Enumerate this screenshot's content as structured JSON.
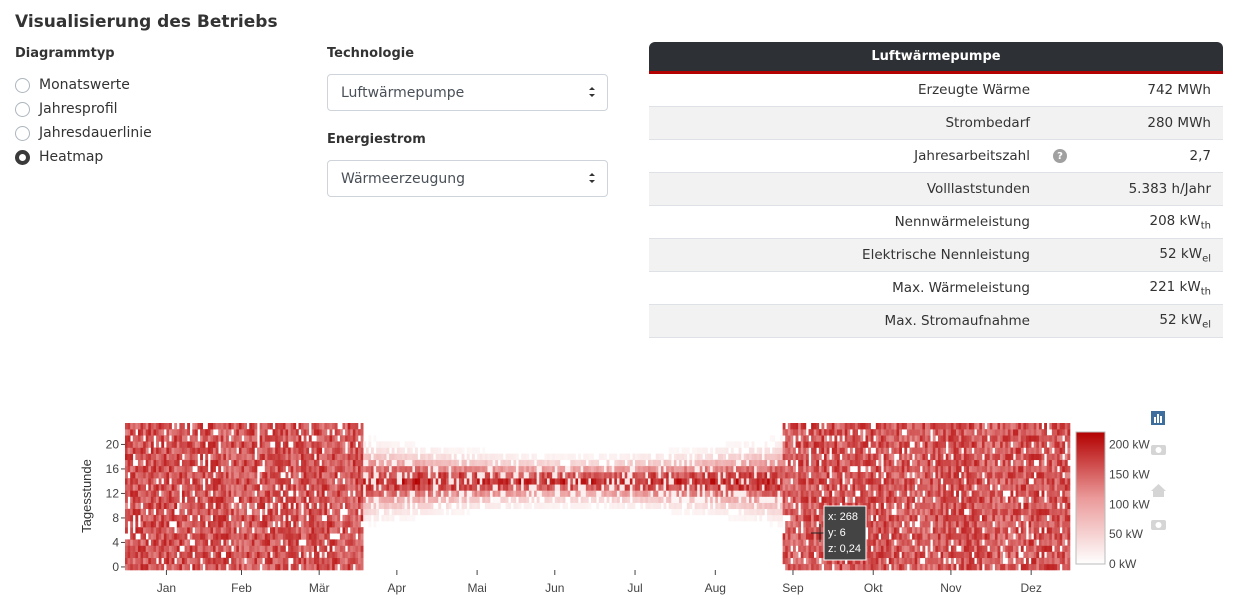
{
  "page": {
    "title": "Visualisierung des Betriebs"
  },
  "diagram_type": {
    "label": "Diagrammtyp",
    "options": [
      {
        "label": "Monatswerte",
        "checked": false
      },
      {
        "label": "Jahresprofil",
        "checked": false
      },
      {
        "label": "Jahresdauerlinie",
        "checked": false
      },
      {
        "label": "Heatmap",
        "checked": true
      }
    ]
  },
  "technology": {
    "label": "Technologie",
    "selected": "Luftwärmepumpe"
  },
  "energy_flow": {
    "label": "Energiestrom",
    "selected": "Wärmeerzeugung"
  },
  "info_table": {
    "title": "Luftwärmepumpe",
    "rows": [
      {
        "label": "Erzeugte Wärme",
        "value": "742 MWh",
        "unit_sub": ""
      },
      {
        "label": "Strombedarf",
        "value": "280 MWh",
        "unit_sub": ""
      },
      {
        "label": "Jahresarbeitszahl",
        "value": "2,7",
        "unit_sub": "",
        "help": true
      },
      {
        "label": "Volllaststunden",
        "value": "5.383 h/Jahr",
        "unit_sub": ""
      },
      {
        "label": "Nennwärmeleistung",
        "value": "208 kW",
        "unit_sub": "th"
      },
      {
        "label": "Elektrische Nennleistung",
        "value": "52 kW",
        "unit_sub": "el"
      },
      {
        "label": "Max. Wärmeleistung",
        "value": "221 kW",
        "unit_sub": "th"
      },
      {
        "label": "Max. Stromaufnahme",
        "value": "52 kW",
        "unit_sub": "el"
      }
    ]
  },
  "colors": {
    "heat_max": "#b30000",
    "heat_mid": "#e06060",
    "heat_min": "#ffffff",
    "header_bg": "#2d3035",
    "accent": "#b30000"
  },
  "chart_data": {
    "type": "heatmap",
    "ylabel": "Tagesstunde",
    "x_range": [
      1,
      365
    ],
    "y_range": [
      0,
      23
    ],
    "z_range": [
      0,
      221
    ],
    "month_ticks": [
      "Jan",
      "Feb",
      "Mär",
      "Apr",
      "Mai",
      "Jun",
      "Jul",
      "Aug",
      "Sep",
      "Okt",
      "Nov",
      "Dez"
    ],
    "y_ticks": [
      0,
      4,
      8,
      12,
      16,
      20
    ],
    "colorbar_ticks": [
      "0 kW",
      "50 kW",
      "100 kW",
      "150 kW",
      "200 kW"
    ],
    "hover": {
      "x": "x: 268",
      "y": "y: 6",
      "z": "z: 0,24"
    }
  }
}
